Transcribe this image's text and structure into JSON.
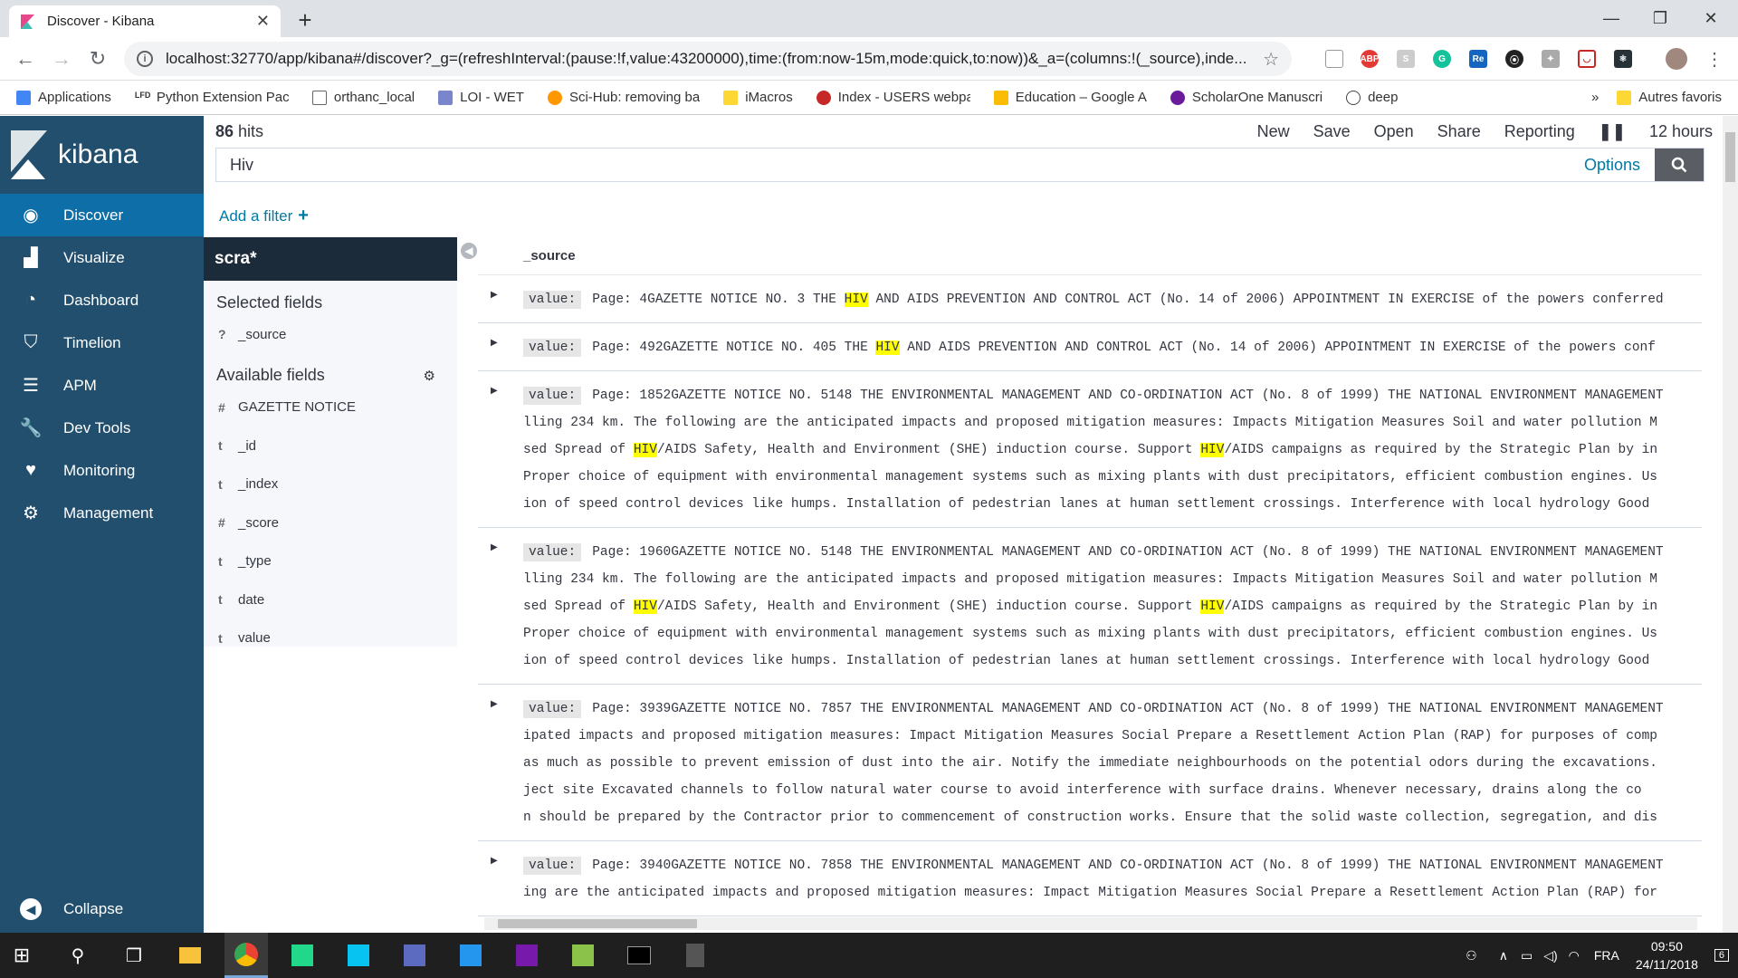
{
  "browser": {
    "tab_title": "Discover - Kibana",
    "url": "localhost:32770/app/kibana#/discover?_g=(refreshInterval:(pause:!f,value:43200000),time:(from:now-15m,mode:quick,to:now))&_a=(columns:!(_source),inde...",
    "bookmarks": [
      {
        "label": "Applications"
      },
      {
        "label": "Python Extension Pac"
      },
      {
        "label": "orthanc_local"
      },
      {
        "label": "LOI - WET"
      },
      {
        "label": "Sci-Hub: removing ba"
      },
      {
        "label": "iMacros"
      },
      {
        "label": "Index - USERS webpa"
      },
      {
        "label": "Education – Google A"
      },
      {
        "label": "ScholarOne Manuscri"
      },
      {
        "label": "deep"
      }
    ],
    "bookmarks_more": "»",
    "bookmarks_other": "Autres favoris"
  },
  "kibana": {
    "logo_text": "kibana",
    "nav": [
      {
        "label": "Discover",
        "icon": "compass-icon"
      },
      {
        "label": "Visualize",
        "icon": "bar-chart-icon"
      },
      {
        "label": "Dashboard",
        "icon": "dashboard-icon"
      },
      {
        "label": "Timelion",
        "icon": "timelion-icon"
      },
      {
        "label": "APM",
        "icon": "apm-icon"
      },
      {
        "label": "Dev Tools",
        "icon": "wrench-icon"
      },
      {
        "label": "Monitoring",
        "icon": "heartbeat-icon"
      },
      {
        "label": "Management",
        "icon": "gear-icon"
      }
    ],
    "collapse_label": "Collapse"
  },
  "discover": {
    "hits_count": "86",
    "hits_label": "hits",
    "menu": {
      "new": "New",
      "save": "Save",
      "open": "Open",
      "share": "Share",
      "reporting": "Reporting",
      "time": "12 hours"
    },
    "query": "Hiv",
    "options_label": "Options",
    "add_filter": "Add a filter",
    "index_pattern": "scra*",
    "selected_fields_title": "Selected fields",
    "selected_fields": [
      {
        "type": "?",
        "name": "_source"
      }
    ],
    "available_fields_title": "Available fields",
    "available_fields": [
      {
        "type": "#",
        "name": "GAZETTE NOTICE"
      },
      {
        "type": "t",
        "name": "_id"
      },
      {
        "type": "t",
        "name": "_index"
      },
      {
        "type": "#",
        "name": "_score"
      },
      {
        "type": "t",
        "name": "_type"
      },
      {
        "type": "t",
        "name": "date"
      },
      {
        "type": "t",
        "name": "value"
      }
    ],
    "column_header": "_source",
    "value_key": "value:"
  },
  "rows": [
    {
      "lines": [
        {
          "parts": [
            "Page: 4GAZETTE NOTICE NO. 3 THE ",
            "HIV",
            " AND AIDS PREVENTION AND CONTROL ACT (No. 14 of 2006) APPOINTMENT IN EXERCISE of the powers conferred"
          ]
        }
      ]
    },
    {
      "lines": [
        {
          "parts": [
            "Page: 492GAZETTE NOTICE NO.  405 THE ",
            "HIV",
            " AND AIDS PREVENTION AND CONTROL ACT (No. 14 of 2006) APPOINTMENT IN EXERCISE of the powers conf"
          ]
        }
      ]
    },
    {
      "lines": [
        {
          "parts": [
            "Page: 1852GAZETTE NOTICE NO. 5148 THE ENVIRONMENTAL MANAGEMENT AND CO-ORDINATION ACT (No. 8 of 1999) THE NATIONAL ENVIRONMENT MANAGEMENT"
          ]
        },
        {
          "parts": [
            "lling 234 km. The following are the anticipated impacts and proposed mitigation measures: Impacts Mitigation Measures Soil and water pollution M"
          ]
        },
        {
          "parts": [
            "sed Spread of ",
            "HIV",
            "/AIDS Safety, Health and Environment (SHE) induction course. Support ",
            "HIV",
            "/AIDS campaigns as required by the Strategic Plan by in"
          ]
        },
        {
          "parts": [
            "Proper choice of equipment with environmental management systems such as mixing plants with dust precipitators, efficient combustion engines. Us"
          ]
        },
        {
          "parts": [
            "ion of speed control devices like humps. Installation of pedestrian lanes at human settlement crossings. Interference with local hydrology Good"
          ]
        }
      ]
    },
    {
      "lines": [
        {
          "parts": [
            "Page: 1960GAZETTE NOTICE NO. 5148 THE ENVIRONMENTAL MANAGEMENT AND CO-ORDINATION ACT (No. 8 of 1999) THE NATIONAL ENVIRONMENT MANAGEMENT"
          ]
        },
        {
          "parts": [
            "lling 234 km. The following are the anticipated impacts and proposed mitigation measures: Impacts Mitigation Measures Soil and water pollution M"
          ]
        },
        {
          "parts": [
            "sed Spread of ",
            "HIV",
            "/AIDS Safety, Health and Environment (SHE) induction course. Support ",
            "HIV",
            "/AIDS campaigns as required by the Strategic Plan by in"
          ]
        },
        {
          "parts": [
            "Proper choice of equipment with environmental management systems such as mixing plants with dust precipitators, efficient combustion engines. Us"
          ]
        },
        {
          "parts": [
            "ion of speed control devices like humps. Installation of pedestrian lanes at human settlement crossings. Interference with local hydrology Good"
          ]
        }
      ]
    },
    {
      "lines": [
        {
          "parts": [
            "Page: 3939GAZETTE NOTICE NO. 7857 THE ENVIRONMENTAL MANAGEMENT AND CO-ORDINATION ACT (No. 8 of 1999) THE NATIONAL ENVIRONMENT MANAGEMENT"
          ]
        },
        {
          "parts": [
            "ipated impacts and proposed mitigation measures: Impact Mitigation Measures Social Prepare a Resettlement Action Plan (RAP) for purposes of comp"
          ]
        },
        {
          "parts": [
            "as much as possible to prevent emission of dust into the air. Notify the immediate neighbourhoods on the potential odors during the excavations."
          ]
        },
        {
          "parts": [
            "ject site   Excavated channels to follow natural water course to avoid interference with surface drains. Whenever necessary, drains along the co"
          ]
        },
        {
          "parts": [
            "n should be prepared by the Contractor prior to commencement of construction works. Ensure that the solid waste collection, segregation, and dis"
          ]
        }
      ]
    },
    {
      "lines": [
        {
          "parts": [
            "Page: 3940GAZETTE NOTICE NO. 7858 THE ENVIRONMENTAL MANAGEMENT AND CO-ORDINATION ACT (No. 8 of 1999) THE NATIONAL ENVIRONMENT MANAGEMENT"
          ]
        },
        {
          "parts": [
            "ing are the anticipated impacts and proposed mitigation measures: Impact Mitigation Measures Social Prepare a Resettlement Action Plan (RAP) for"
          ]
        }
      ]
    }
  ],
  "taskbar": {
    "language": "FRA",
    "time": "09:50",
    "date": "24/11/2018",
    "notifications": "6"
  },
  "colors": {
    "sidebar": "#224f6e",
    "sidebar_active": "#0e6ea8",
    "link": "#0079a5",
    "highlight": "#ffff00"
  }
}
